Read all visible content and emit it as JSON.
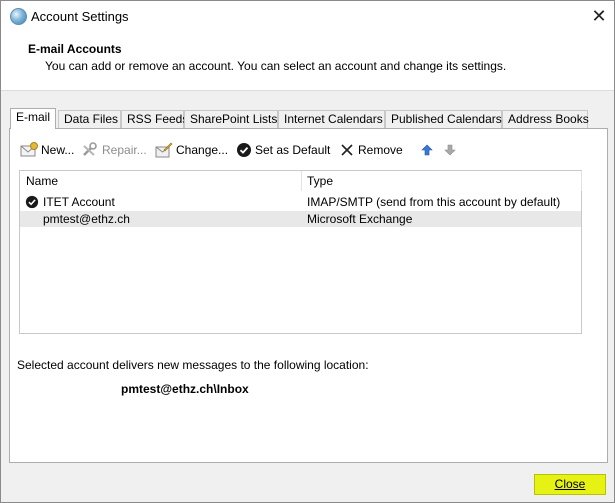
{
  "window": {
    "title": "Account Settings",
    "close_glyph": "✕"
  },
  "header": {
    "title": "E-mail Accounts",
    "description": "You can add or remove an account. You can select an account and change its settings."
  },
  "tabs": [
    {
      "label": "E-mail",
      "active": true
    },
    {
      "label": "Data Files"
    },
    {
      "label": "RSS Feeds"
    },
    {
      "label": "SharePoint Lists"
    },
    {
      "label": "Internet Calendars"
    },
    {
      "label": "Published Calendars"
    },
    {
      "label": "Address Books"
    }
  ],
  "toolbar": {
    "new_label": "New...",
    "repair_label": "Repair...",
    "change_label": "Change...",
    "default_label": "Set as Default",
    "remove_label": "Remove"
  },
  "accounts": {
    "columns": {
      "name": "Name",
      "type": "Type"
    },
    "rows": [
      {
        "name": "ITET Account",
        "type": "IMAP/SMTP (send from this account by default)",
        "default": true
      },
      {
        "name": "pmtest@ethz.ch",
        "type": "Microsoft Exchange",
        "selected": true
      }
    ]
  },
  "delivery": {
    "label": "Selected account delivers new messages to the following location:",
    "path": "pmtest@ethz.ch\\Inbox"
  },
  "footer": {
    "close_label": "Close",
    "close_highlight": "#e6f213"
  },
  "icons": [
    "globe-icon",
    "close-icon",
    "new-mail-icon",
    "repair-icon",
    "change-icon",
    "checkmark-icon",
    "remove-icon",
    "arrow-up-icon",
    "arrow-down-icon"
  ]
}
